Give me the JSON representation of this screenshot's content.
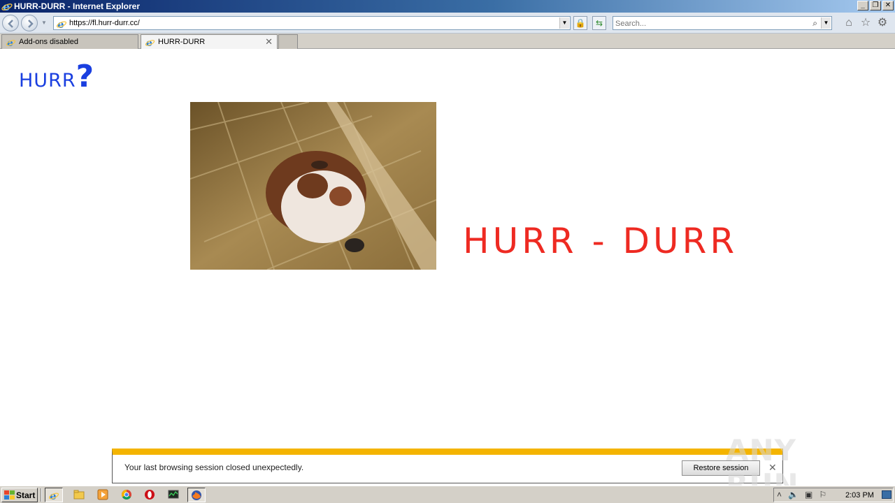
{
  "window": {
    "title": "HURR-DURR - Internet Explorer",
    "controls": [
      "_",
      "❐",
      "✕"
    ]
  },
  "navbar": {
    "url": "https://fl.hurr-durr.cc/",
    "search_placeholder": "Search..."
  },
  "tabs": [
    {
      "label": "Add-ons disabled",
      "active": false
    },
    {
      "label": "HURR-DURR",
      "active": true
    }
  ],
  "page": {
    "hurr_word": "HURR",
    "hurr_mark": "?",
    "headline": "HURR - DURR",
    "colors": {
      "hurr": "#1a3fe0",
      "headline": "#ee2a22"
    }
  },
  "notification": {
    "message": "Your last browsing session closed unexpectedly.",
    "restore_label": "Restore session",
    "accent": "#f4b400"
  },
  "watermark": {
    "text": "ANY RUN"
  },
  "taskbar": {
    "start_label": "Start",
    "quick_launch": [
      "internet-explorer-icon",
      "explorer-folder-icon",
      "media-player-icon",
      "chrome-icon",
      "opera-icon",
      "task-manager-icon",
      "firefox-icon"
    ],
    "clock": "2:03 PM"
  }
}
